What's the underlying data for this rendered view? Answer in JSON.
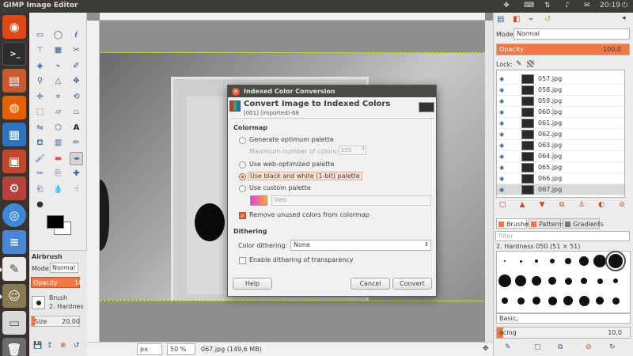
{
  "topbar": {
    "title": "GIMP Image Editor",
    "clock": "20:19",
    "tray_icons": [
      "dropbox-icon",
      "keyboard-icon",
      "network-icon",
      "volume-icon",
      "mail-icon",
      "power-icon"
    ]
  },
  "launcher": {
    "items": [
      "ubuntu-dash",
      "terminal",
      "files",
      "firefox",
      "libreoffice-writer",
      "libreoffice-impress",
      "system-settings",
      "chromium",
      "text-editor",
      "text-editor-pen",
      "gimp",
      "drive",
      "trash"
    ]
  },
  "toolbox": {
    "panel_title": "Airbrush",
    "mode_label": "Mode:",
    "mode_value": "Normal",
    "opacity_label": "Opacity",
    "opacity_value": "10",
    "brush_label": "Brush",
    "brush_value": "2. Hardnes",
    "size_label": "Size",
    "size_value": "20,00"
  },
  "canvas": {
    "unit": "px",
    "zoom": "50 %",
    "status": "067.jpg (149,6 MB)"
  },
  "dock": {
    "mode_label": "Mode:",
    "mode_value": "Normal",
    "opacity_label": "Opacity",
    "opacity_value": "100,0",
    "opacity_fraction": 1.0,
    "lock_label": "Lock:",
    "layers": [
      "057.jpg",
      "058.jpg",
      "059.jpg",
      "060.jpg",
      "061.jpg",
      "062.jpg",
      "063.jpg",
      "064.jpg",
      "065.jpg",
      "066.jpg",
      "067.jpg"
    ],
    "selected_layer": "067.jpg",
    "tabs": [
      "Brushes",
      "Patterns",
      "Gradients"
    ],
    "filter_placeholder": "filter",
    "brush_name": "2. Hardness 050 (51 × 51)",
    "tag_value": "Basic,",
    "spacing_label": "acing",
    "spacing_value": "10,0",
    "spacing_fraction": 0.05
  },
  "dialog": {
    "title": "Indexed Color Conversion",
    "heading": "Convert Image to Indexed Colors",
    "subheading": "[001] (imported)-68",
    "colormap_header": "Colormap",
    "opt_optimum": "Generate optimum palette",
    "max_colors_label": "Maximum number of colors:",
    "max_colors_value": "255",
    "opt_web": "Use web-optimized palette",
    "opt_bw": "Use black and white (1-bit) palette",
    "opt_custom": "Use custom palette",
    "custom_palette_value": "Web",
    "remove_unused": "Remove unused colors from colormap",
    "dithering_header": "Dithering",
    "color_dithering_label": "Color dithering:",
    "color_dithering_value": "None",
    "dither_transparency": "Enable dithering of transparency",
    "help_label": "Help",
    "cancel_label": "Cancel",
    "convert_label": "Convert"
  },
  "colors": {
    "accent": "#f07746",
    "panel_bg": "#edeceb",
    "titlebar": "#3c3b37"
  }
}
